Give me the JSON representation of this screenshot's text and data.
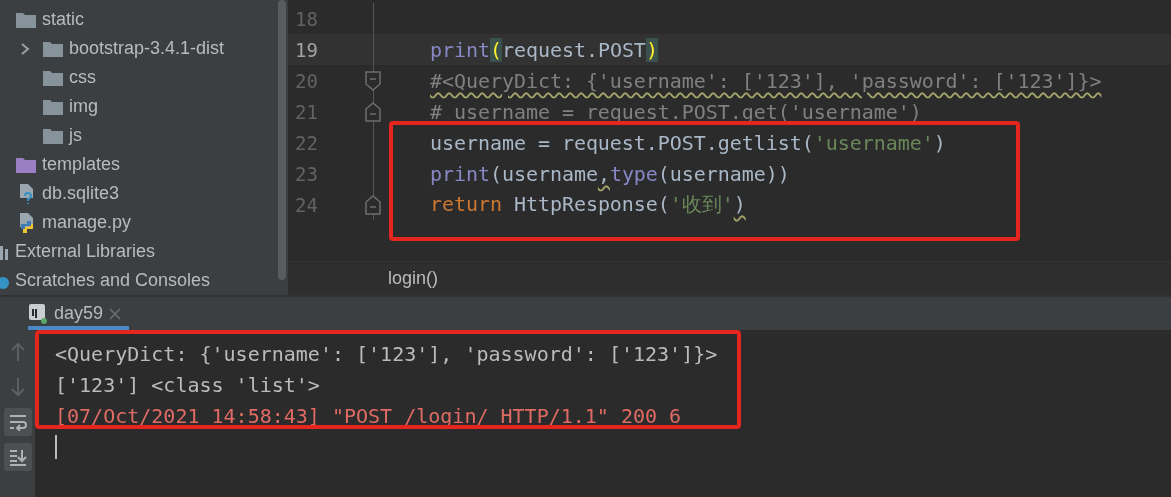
{
  "sidebar": {
    "project_items": [
      {
        "label": "static",
        "kind": "folder",
        "children": [
          {
            "label": "bootstrap-3.4.1-dist",
            "kind": "folder",
            "expanded": false
          },
          {
            "label": "css",
            "kind": "folder"
          },
          {
            "label": "img",
            "kind": "folder"
          },
          {
            "label": "js",
            "kind": "folder"
          }
        ]
      },
      {
        "label": "templates",
        "kind": "template-folder"
      },
      {
        "label": "db.sqlite3",
        "kind": "unknown-file"
      },
      {
        "label": "manage.py",
        "kind": "python-file"
      }
    ],
    "root_items": [
      {
        "label": "External Libraries",
        "kind": "libraries"
      },
      {
        "label": "Scratches and Consoles",
        "kind": "scratches"
      }
    ]
  },
  "editor": {
    "lines": [
      {
        "number": "18",
        "current": false
      },
      {
        "number": "19",
        "current": true,
        "tokens": [
          {
            "text": "print",
            "kind": "builtin"
          },
          {
            "text": "(",
            "kind": "brace-match"
          },
          {
            "text": "request.POST",
            "kind": "plain"
          },
          {
            "text": ")",
            "kind": "brace-match"
          }
        ]
      },
      {
        "number": "20",
        "current": false,
        "fold_start": true,
        "tokens": [
          {
            "text": "#<QueryDict: {'username': ['123'], 'password': ['123']}>",
            "kind": "comment",
            "warning": true
          }
        ]
      },
      {
        "number": "21",
        "current": false,
        "fold_end": true,
        "tokens": [
          {
            "text": "# username = request.POST.get('username')",
            "kind": "comment"
          }
        ]
      },
      {
        "number": "22",
        "current": false,
        "tokens": [
          {
            "text": "username = request.POST.getlist(",
            "kind": "plain"
          },
          {
            "text": "'username'",
            "kind": "string"
          },
          {
            "text": ")",
            "kind": "plain"
          }
        ]
      },
      {
        "number": "23",
        "current": false,
        "tokens": [
          {
            "text": "print",
            "kind": "builtin"
          },
          {
            "text": "(username",
            "kind": "plain"
          },
          {
            "text": ",",
            "kind": "plain",
            "warning": true
          },
          {
            "text": "type",
            "kind": "builtin"
          },
          {
            "text": "(username))",
            "kind": "plain"
          }
        ]
      },
      {
        "number": "24",
        "current": false,
        "fold_end": true,
        "tokens": [
          {
            "text": "return",
            "kind": "keyword"
          },
          {
            "text": " HttpResponse(",
            "kind": "plain"
          },
          {
            "text": "'收到'",
            "kind": "string"
          },
          {
            "text": ")",
            "kind": "plain",
            "warning": true
          }
        ]
      }
    ],
    "breadcrumb": "login()"
  },
  "run_panel": {
    "tabs": [
      {
        "label": "day59",
        "selected": true
      }
    ],
    "lines": [
      {
        "text": "<QueryDict: {'username': ['123'], 'password': ['123']}>",
        "kind": "stdout"
      },
      {
        "text": "['123'] <class 'list'>",
        "kind": "stdout"
      },
      {
        "text": "[07/Oct/2021 14:58:43] \"POST /login/ HTTP/1.1\" 200 6",
        "kind": "stderr"
      }
    ]
  }
}
